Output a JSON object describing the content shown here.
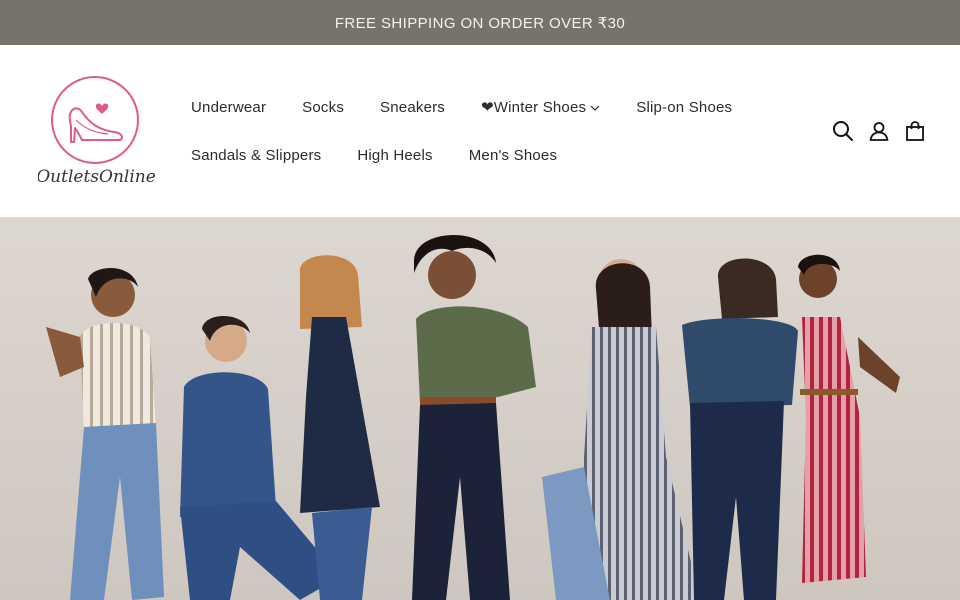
{
  "announcement": {
    "text": "FREE SHIPPING ON ORDER OVER ₹30"
  },
  "logo": {
    "text": "OutletsOnline"
  },
  "nav": {
    "row1": [
      {
        "label": "Underwear"
      },
      {
        "label": "Socks"
      },
      {
        "label": "Sneakers"
      },
      {
        "label": "❤Winter Shoes",
        "has_dropdown": true
      },
      {
        "label": "Slip-on Shoes"
      }
    ],
    "row2": [
      {
        "label": "Sandals & Slippers"
      },
      {
        "label": "High Heels"
      },
      {
        "label": "Men's Shoes"
      }
    ]
  },
  "header_icons": [
    "search-icon",
    "account-icon",
    "cart-icon"
  ],
  "hero": {
    "image": "hero-banner-image",
    "description_only_visual": true
  },
  "colors": {
    "announcement_bg": "#77726c",
    "announcement_text": "#f4f1ec",
    "logo_pink": "#e05a86",
    "nav_text": "#2b2b2b",
    "hero_bg": "#dcd6d0"
  }
}
